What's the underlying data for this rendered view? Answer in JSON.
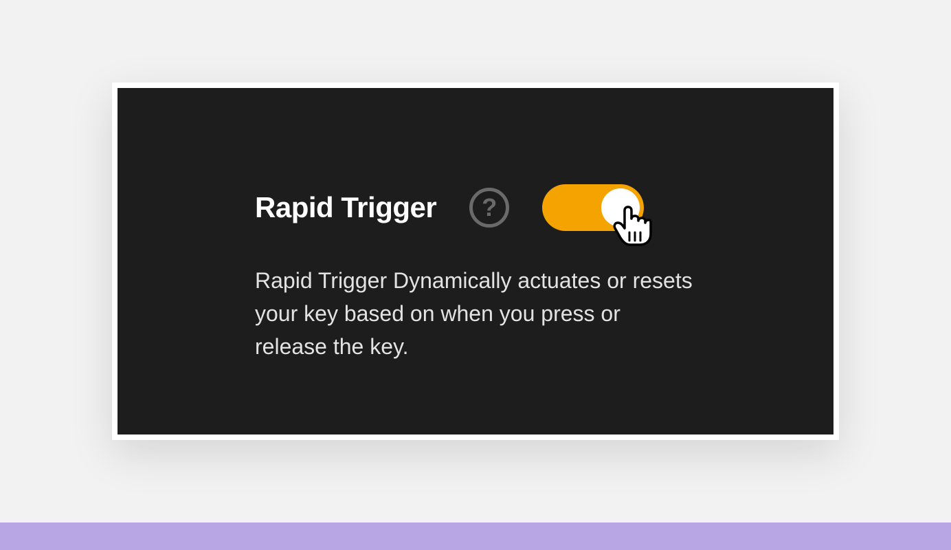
{
  "card": {
    "title": "Rapid Trigger",
    "help_glyph": "?",
    "toggle_state": "on",
    "description": "Rapid Trigger Dynamically actuates or resets your key based on when you press or release the key."
  },
  "colors": {
    "accent": "#f5a300",
    "panel": "#1d1d1d",
    "band": "#b8a5e3"
  }
}
